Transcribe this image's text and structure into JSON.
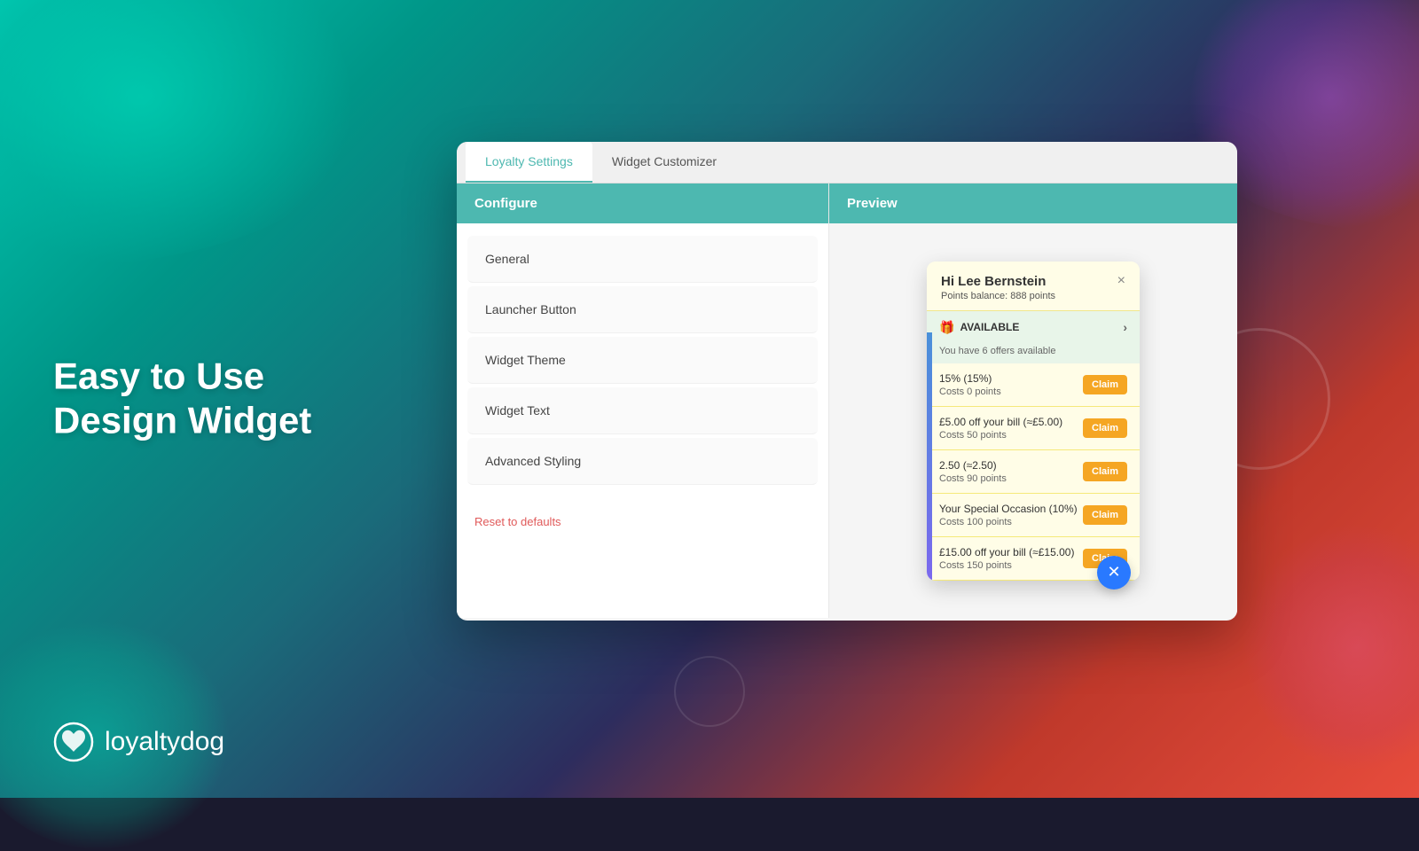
{
  "background": {
    "gradient": "teal-to-red"
  },
  "left_text": {
    "line1": "Easy to Use",
    "line2": "Design Widget"
  },
  "logo": {
    "text": "loyaltydog"
  },
  "tabs": [
    {
      "id": "loyalty-settings",
      "label": "Loyalty Settings",
      "active": true
    },
    {
      "id": "widget-customizer",
      "label": "Widget Customizer",
      "active": false
    }
  ],
  "configure": {
    "header": "Configure",
    "menu_items": [
      {
        "id": "general",
        "label": "General"
      },
      {
        "id": "launcher-button",
        "label": "Launcher Button"
      },
      {
        "id": "widget-theme",
        "label": "Widget Theme"
      },
      {
        "id": "widget-text",
        "label": "Widget Text"
      },
      {
        "id": "advanced-styling",
        "label": "Advanced Styling"
      }
    ],
    "reset_label": "Reset to defaults"
  },
  "preview": {
    "header": "Preview",
    "widget": {
      "greeting": "Hi Lee Bernstein",
      "points_balance": "Points balance: 888 points",
      "available_label": "AVAILABLE",
      "offers_count": "You have 6 offers available",
      "close_x": "×",
      "offers": [
        {
          "title": "15% (15%)",
          "cost": "Costs 0 points",
          "button": "Claim"
        },
        {
          "title": "£5.00 off your bill (≈£5.00)",
          "cost": "Costs 50 points",
          "button": "Claim"
        },
        {
          "title": "2.50 (≈2.50)",
          "cost": "Costs 90 points",
          "button": "Claim"
        },
        {
          "title": "Your Special Occasion (10%)",
          "cost": "Costs 100 points",
          "button": "Claim"
        },
        {
          "title": "£15.00 off your bill (≈£15.00)",
          "cost": "Costs 150 points",
          "button": "Claim"
        }
      ]
    }
  }
}
